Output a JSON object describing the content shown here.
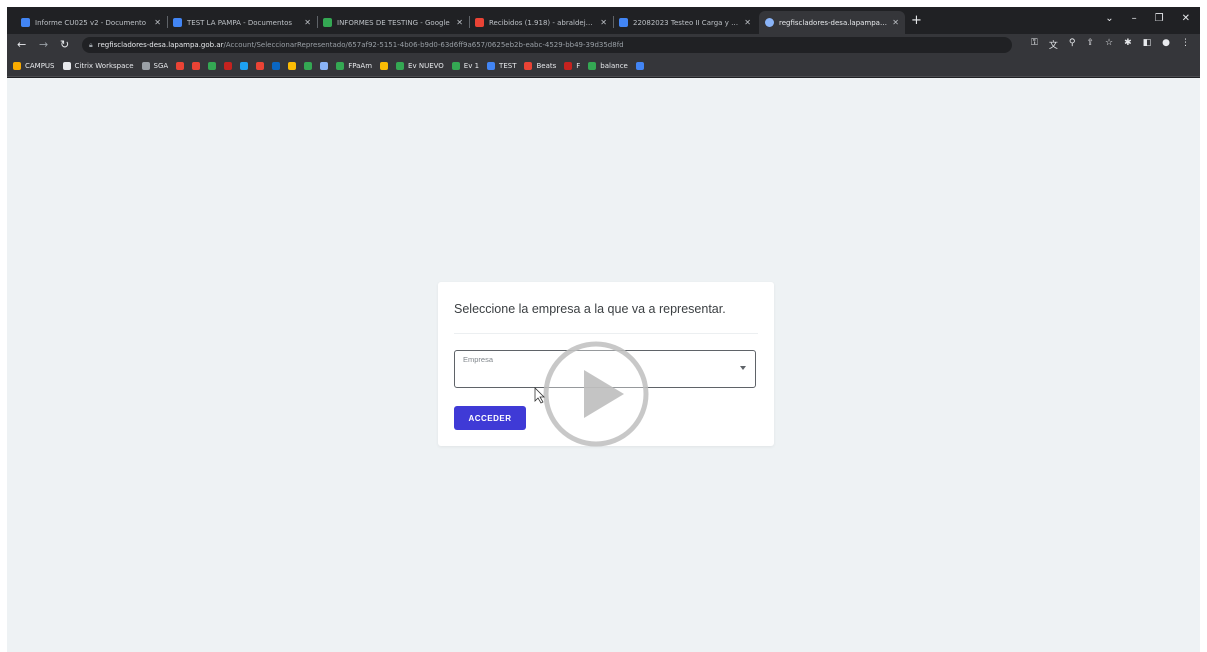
{
  "browser": {
    "tabs": [
      {
        "title": "Informe CU025 v2 - Documento",
        "favicon_color": "#4285f4"
      },
      {
        "title": "TEST LA PAMPA - Documentos",
        "favicon_color": "#4285f4"
      },
      {
        "title": "INFORMES DE TESTING - Google",
        "favicon_color": "#34a853"
      },
      {
        "title": "Recibidos (1.918) - abraldejans",
        "favicon_color": "#ea4335"
      },
      {
        "title": "22082023 Testeo II Carga y Eval.",
        "favicon_color": "#4285f4"
      },
      {
        "title": "regfiscladores-desa.lapampa.gob.",
        "favicon_color": "#8ab4f8"
      }
    ],
    "new_tab": "+",
    "url_host": "regfiscladores-desa.lapampa.gob.ar",
    "url_path": "/Account/SeleccionarRepresentado/657af92-5151-4b06-b9d0-63d6ff9a657/0625eb2b-eabc-4529-bb49-39d35d8fd",
    "bookmarks": [
      {
        "label": "CAMPUS",
        "color": "#f9ab00"
      },
      {
        "label": "Citrix Workspace",
        "color": "#e8eaed"
      },
      {
        "label": "SGA",
        "color": "#9aa0a6"
      },
      {
        "label": "",
        "color": "#ea4335"
      },
      {
        "label": "",
        "color": "#ea4335"
      },
      {
        "label": "",
        "color": "#34a853"
      },
      {
        "label": "",
        "color": "#c5221f"
      },
      {
        "label": "",
        "color": "#1da1f2"
      },
      {
        "label": "",
        "color": "#ea4335"
      },
      {
        "label": "",
        "color": "#0a66c2"
      },
      {
        "label": "",
        "color": "#fbbc04"
      },
      {
        "label": "",
        "color": "#34a853"
      },
      {
        "label": "",
        "color": "#8ab4f8"
      },
      {
        "label": "FPaAm",
        "color": "#34a853"
      },
      {
        "label": "",
        "color": "#fbbc04"
      },
      {
        "label": "Ev NUEVO",
        "color": "#34a853"
      },
      {
        "label": "Ev 1",
        "color": "#34a853"
      },
      {
        "label": "TEST",
        "color": "#4285f4"
      },
      {
        "label": "Beats",
        "color": "#ea4335"
      },
      {
        "label": "F",
        "color": "#c5221f"
      },
      {
        "label": "balance",
        "color": "#34a853"
      },
      {
        "label": "",
        "color": "#4285f4"
      }
    ]
  },
  "page": {
    "title": "Seleccione la empresa a la que va a representar.",
    "select_label": "Empresa",
    "submit_label": "ACCEDER",
    "accent_color": "#3f3ad6"
  },
  "icons": {
    "play_overlay": "play-icon",
    "cursor": "mouse-cursor-icon"
  }
}
